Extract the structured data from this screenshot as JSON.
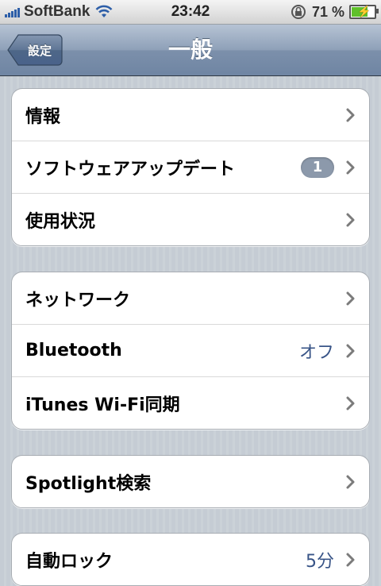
{
  "status": {
    "carrier": "SoftBank",
    "time": "23:42",
    "battery_percent": "71 %",
    "battery_level": 0.71,
    "icons": [
      "signal-icon",
      "wifi-icon",
      "rotation-lock-icon",
      "battery-icon"
    ]
  },
  "nav": {
    "back_label": "設定",
    "title": "一般"
  },
  "groups": [
    {
      "rows": [
        {
          "label": "情報"
        },
        {
          "label": "ソフトウェアアップデート",
          "badge": "1"
        },
        {
          "label": "使用状況"
        }
      ]
    },
    {
      "rows": [
        {
          "label": "ネットワーク"
        },
        {
          "label": "Bluetooth",
          "value": "オフ"
        },
        {
          "label": "iTunes Wi-Fi同期"
        }
      ]
    },
    {
      "rows": [
        {
          "label": "Spotlight検索"
        }
      ]
    },
    {
      "rows": [
        {
          "label": "自動ロック",
          "value": "5分"
        }
      ]
    }
  ],
  "colors": {
    "value_text": "#385487",
    "badge_bg": "#8c99ab",
    "background": "#c5ccd4"
  }
}
